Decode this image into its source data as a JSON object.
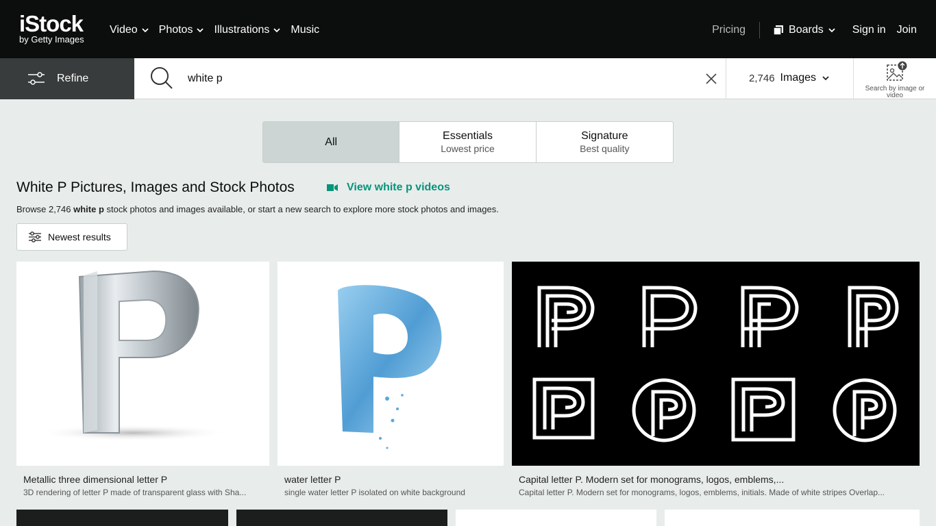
{
  "brand": {
    "name": "iStock",
    "tagline": "by Getty Images"
  },
  "nav": {
    "items": [
      {
        "label": "Video",
        "has_menu": true
      },
      {
        "label": "Photos",
        "has_menu": true
      },
      {
        "label": "Illustrations",
        "has_menu": true
      },
      {
        "label": "Music",
        "has_menu": false
      }
    ],
    "pricing": "Pricing",
    "boards": "Boards",
    "signin": "Sign in",
    "join": "Join"
  },
  "search": {
    "refine_label": "Refine",
    "query": "white p",
    "count_num": "2,746",
    "count_type": "Images",
    "visual_search_label": "Search by image or video"
  },
  "tabs": [
    {
      "label": "All",
      "sub": "",
      "active": true
    },
    {
      "label": "Essentials",
      "sub": "Lowest price",
      "active": false
    },
    {
      "label": "Signature",
      "sub": "Best quality",
      "active": false
    }
  ],
  "results": {
    "heading": "White P Pictures, Images and Stock Photos",
    "video_link": "View white p videos",
    "browse_prefix": "Browse 2,746 ",
    "browse_term": "white p",
    "browse_suffix": " stock photos and images available, or start a new search to explore more stock photos and images.",
    "sort_label": "Newest results"
  },
  "cards": [
    {
      "title": "Metallic three dimensional letter P",
      "desc": "3D rendering of letter P made of transparent glass with Sha..."
    },
    {
      "title": "water letter P",
      "desc": "single water letter P isolated on white background"
    },
    {
      "title": "Capital letter P. Modern set for monograms, logos, emblems,...",
      "desc": "Capital letter P. Modern set for monograms, logos, emblems, initials. Made of white stripes Overlap..."
    }
  ],
  "colors": {
    "topbar": "#0c0d0d",
    "accent": "#08947a",
    "background": "#e8edec",
    "refine_bg": "#393c3c"
  }
}
